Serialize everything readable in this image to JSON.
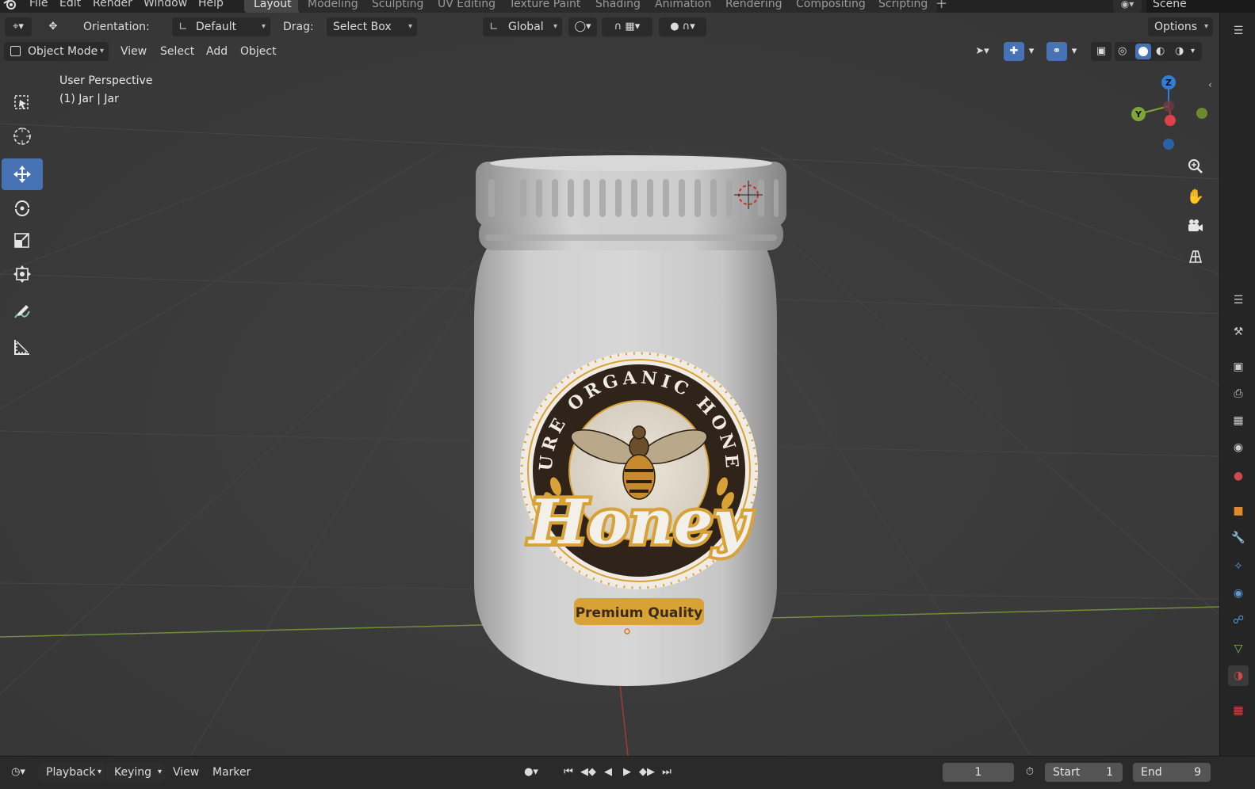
{
  "menu": {
    "items": [
      "File",
      "Edit",
      "Render",
      "Window",
      "Help"
    ]
  },
  "workspaces": [
    "Layout",
    "Modeling",
    "Sculpting",
    "UV Editing",
    "Texture Paint",
    "Shading",
    "Animation",
    "Rendering",
    "Compositing",
    "Scripting"
  ],
  "active_workspace": "Layout",
  "scene": {
    "name": "Scene"
  },
  "tool_header": {
    "orientation_label": "Orientation:",
    "orientation_value": "Default",
    "drag_label": "Drag:",
    "drag_value": "Select Box",
    "transform_orientation": "Global",
    "options_label": "Options"
  },
  "viewport_header": {
    "mode": "Object Mode",
    "menus": [
      "View",
      "Select",
      "Add",
      "Object"
    ]
  },
  "viewport": {
    "view_name": "User Perspective",
    "object_info": "(1) Jar | Jar"
  },
  "gizmo": {
    "z": "Z",
    "y": "Y"
  },
  "label": {
    "line1": "PURE ORGANIC HONEY",
    "brand": "Honey",
    "badge": "Premium Quality"
  },
  "timeline": {
    "menus": [
      "Playback",
      "Keying",
      "View",
      "Marker"
    ],
    "current_frame": "1",
    "start_label": "Start",
    "start_value": "1",
    "end_label": "End",
    "end_value": "9"
  },
  "colors": {
    "accent": "#4772b3",
    "viewport_bg": "#3b3b3b",
    "axis_x": "#b53a3a",
    "axis_y": "#7fa437",
    "axis_z": "#2f7fd6",
    "honey_gold": "#d8a236",
    "label_dark": "#2f231a"
  }
}
